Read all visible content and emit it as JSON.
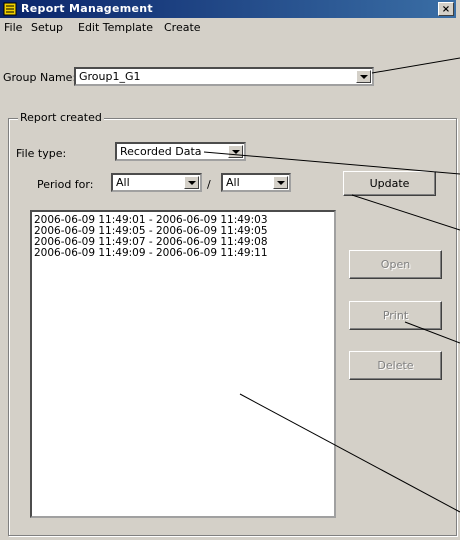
{
  "window": {
    "title": "Report Management",
    "close_glyph": "×"
  },
  "menu": [
    {
      "label": "File"
    },
    {
      "label": "Setup"
    },
    {
      "label": "Edit Template"
    },
    {
      "label": "Create"
    }
  ],
  "group_name": {
    "label": "Group Name:",
    "value": "Group1_G1"
  },
  "report_created": {
    "legend": "Report created",
    "file_type": {
      "label": "File type:",
      "value": "Recorded Data"
    },
    "period": {
      "label": "Period for:",
      "from": "All",
      "separator": "/",
      "to": "All"
    },
    "update_button": "Update",
    "entries": [
      "2006-06-09 11:49:01 - 2006-06-09 11:49:03",
      "2006-06-09 11:49:05 - 2006-06-09 11:49:05",
      "2006-06-09 11:49:07 - 2006-06-09 11:49:08",
      "2006-06-09 11:49:09 - 2006-06-09 11:49:11"
    ],
    "buttons": {
      "open": "Open",
      "print": "Print",
      "delete": "Delete"
    }
  },
  "colors": {
    "titlebar": "#0a246a",
    "face": "#d4d0c8",
    "disabled_text": "#808080"
  },
  "icons": [
    "app-icon",
    "close-icon",
    "dropdown-arrow-icon"
  ]
}
